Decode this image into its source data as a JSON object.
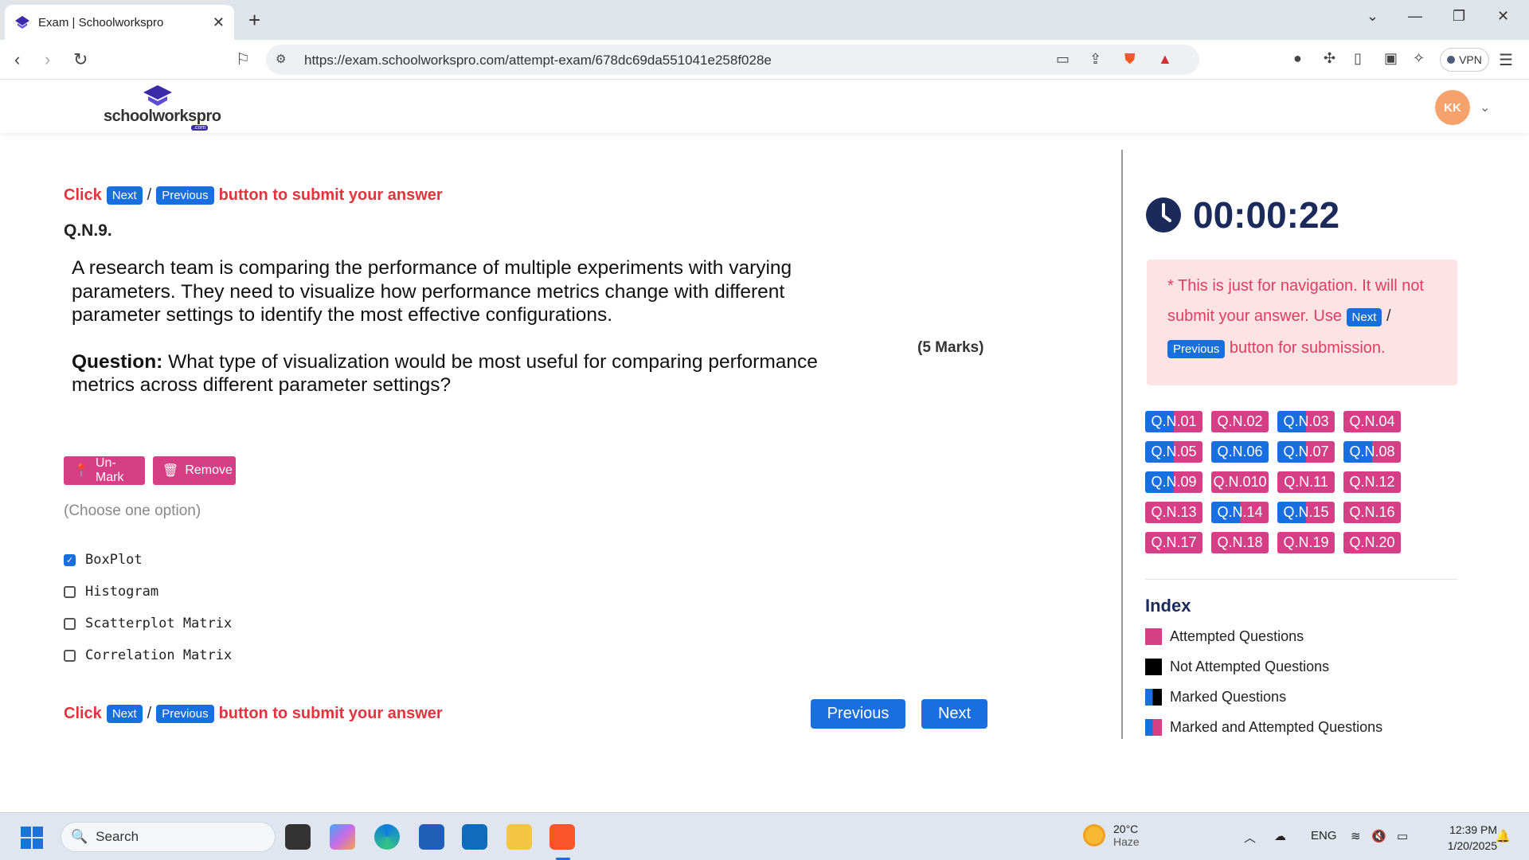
{
  "browser": {
    "tab_title": "Exam | Schoolworkspro",
    "url": "https://exam.schoolworkspro.com/attempt-exam/678dc69da551041e258f028e",
    "vpn_label": "VPN"
  },
  "site": {
    "logo_text": "schoolworkspro",
    "logo_sub": ".com",
    "avatar_initials": "KK"
  },
  "instruction": {
    "click": "Click",
    "next": "Next",
    "slash": "/",
    "previous": "Previous",
    "tail": "button to submit your answer"
  },
  "question": {
    "number": "Q.N.9.",
    "paragraph": "A research team is comparing the performance of multiple experiments with varying parameters. They need to visualize how performance metrics change with different parameter settings to identify the most effective configurations.",
    "question_label": "Question:",
    "question_text": " What type of visualization would be most useful for comparing performance metrics across different parameter settings?",
    "marks": "(5 Marks)"
  },
  "actions": {
    "unmark": "Un-Mark",
    "remove": "Remove"
  },
  "choose_hint": "(Choose one option)",
  "options": [
    {
      "label": "BoxPlot",
      "checked": true
    },
    {
      "label": "Histogram",
      "checked": false
    },
    {
      "label": "Scatterplot Matrix",
      "checked": false
    },
    {
      "label": "Correlation Matrix",
      "checked": false
    }
  ],
  "nav": {
    "previous": "Previous",
    "next": "Next"
  },
  "timer": "00:00:22",
  "notice": {
    "part1": "* This is just for navigation. It will not submit your answer. Use",
    "next": "Next",
    "slash": "/",
    "previous": "Previous",
    "part2": "button for submission."
  },
  "questions": [
    {
      "label": "Q.N.01",
      "state": "marked"
    },
    {
      "label": "Q.N.02",
      "state": "att"
    },
    {
      "label": "Q.N.03",
      "state": "marked"
    },
    {
      "label": "Q.N.04",
      "state": "att"
    },
    {
      "label": "Q.N.05",
      "state": "marked"
    },
    {
      "label": "Q.N.06",
      "state": "markedfull"
    },
    {
      "label": "Q.N.07",
      "state": "marked"
    },
    {
      "label": "Q.N.08",
      "state": "marked"
    },
    {
      "label": "Q.N.09",
      "state": "marked"
    },
    {
      "label": "Q.N.010",
      "state": "att"
    },
    {
      "label": "Q.N.11",
      "state": "att"
    },
    {
      "label": "Q.N.12",
      "state": "att"
    },
    {
      "label": "Q.N.13",
      "state": "att"
    },
    {
      "label": "Q.N.14",
      "state": "marked"
    },
    {
      "label": "Q.N.15",
      "state": "marked"
    },
    {
      "label": "Q.N.16",
      "state": "att"
    },
    {
      "label": "Q.N.17",
      "state": "att"
    },
    {
      "label": "Q.N.18",
      "state": "att"
    },
    {
      "label": "Q.N.19",
      "state": "att"
    },
    {
      "label": "Q.N.20",
      "state": "att"
    }
  ],
  "index": {
    "title": "Index",
    "items": [
      {
        "label": "Attempted Questions",
        "swatch": "att"
      },
      {
        "label": "Not Attempted Questions",
        "swatch": "not"
      },
      {
        "label": "Marked Questions",
        "swatch": "mark"
      },
      {
        "label": "Marked and Attempted Questions",
        "swatch": "ma"
      }
    ]
  },
  "colors": {
    "accent_blue": "#1a6fe0",
    "attempted_pink": "#d63f86",
    "instruction_red": "#e3343e",
    "timer_navy": "#1c2a5b"
  },
  "taskbar": {
    "search_placeholder": "Search",
    "weather_temp": "20°C",
    "weather_desc": "Haze",
    "language": "ENG",
    "time": "12:39 PM",
    "date": "1/20/2025"
  }
}
